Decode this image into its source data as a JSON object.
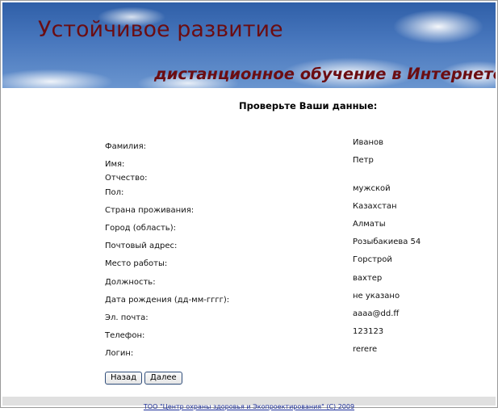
{
  "header": {
    "title": "Устойчивое развитие",
    "subtitle": "дистанционное обучение в Интернете"
  },
  "form": {
    "heading": "Проверьте Ваши данные:",
    "rows": [
      {
        "label": "Фамилия:",
        "value": "Иванов"
      },
      {
        "label": "Имя:",
        "value": "Петр"
      },
      {
        "label": "Отчество:",
        "value": ""
      },
      {
        "label": "Пол:",
        "value": "мужской"
      },
      {
        "label": "Страна проживания:",
        "value": "Казахстан"
      },
      {
        "label": "Город (область):",
        "value": "Алматы"
      },
      {
        "label": "Почтовый адрес:",
        "value": "Розыбакиева 54"
      },
      {
        "label": "Место работы:",
        "value": "Горстрой"
      },
      {
        "label": "Должность:",
        "value": "вахтер"
      },
      {
        "label": "Дата рождения (дд-мм-гггг):",
        "value": "не указано"
      },
      {
        "label": "Эл. почта:",
        "value": "aaaa@dd.ff"
      },
      {
        "label": "Телефон:",
        "value": "123123"
      },
      {
        "label": "Логин:",
        "value": "rerere"
      }
    ]
  },
  "buttons": {
    "back_label": "Назад",
    "next_label": "Далее"
  },
  "footer": {
    "text": "ТОО \"Центр охраны здоровья и Экопроектирования\" (С) 2009"
  }
}
